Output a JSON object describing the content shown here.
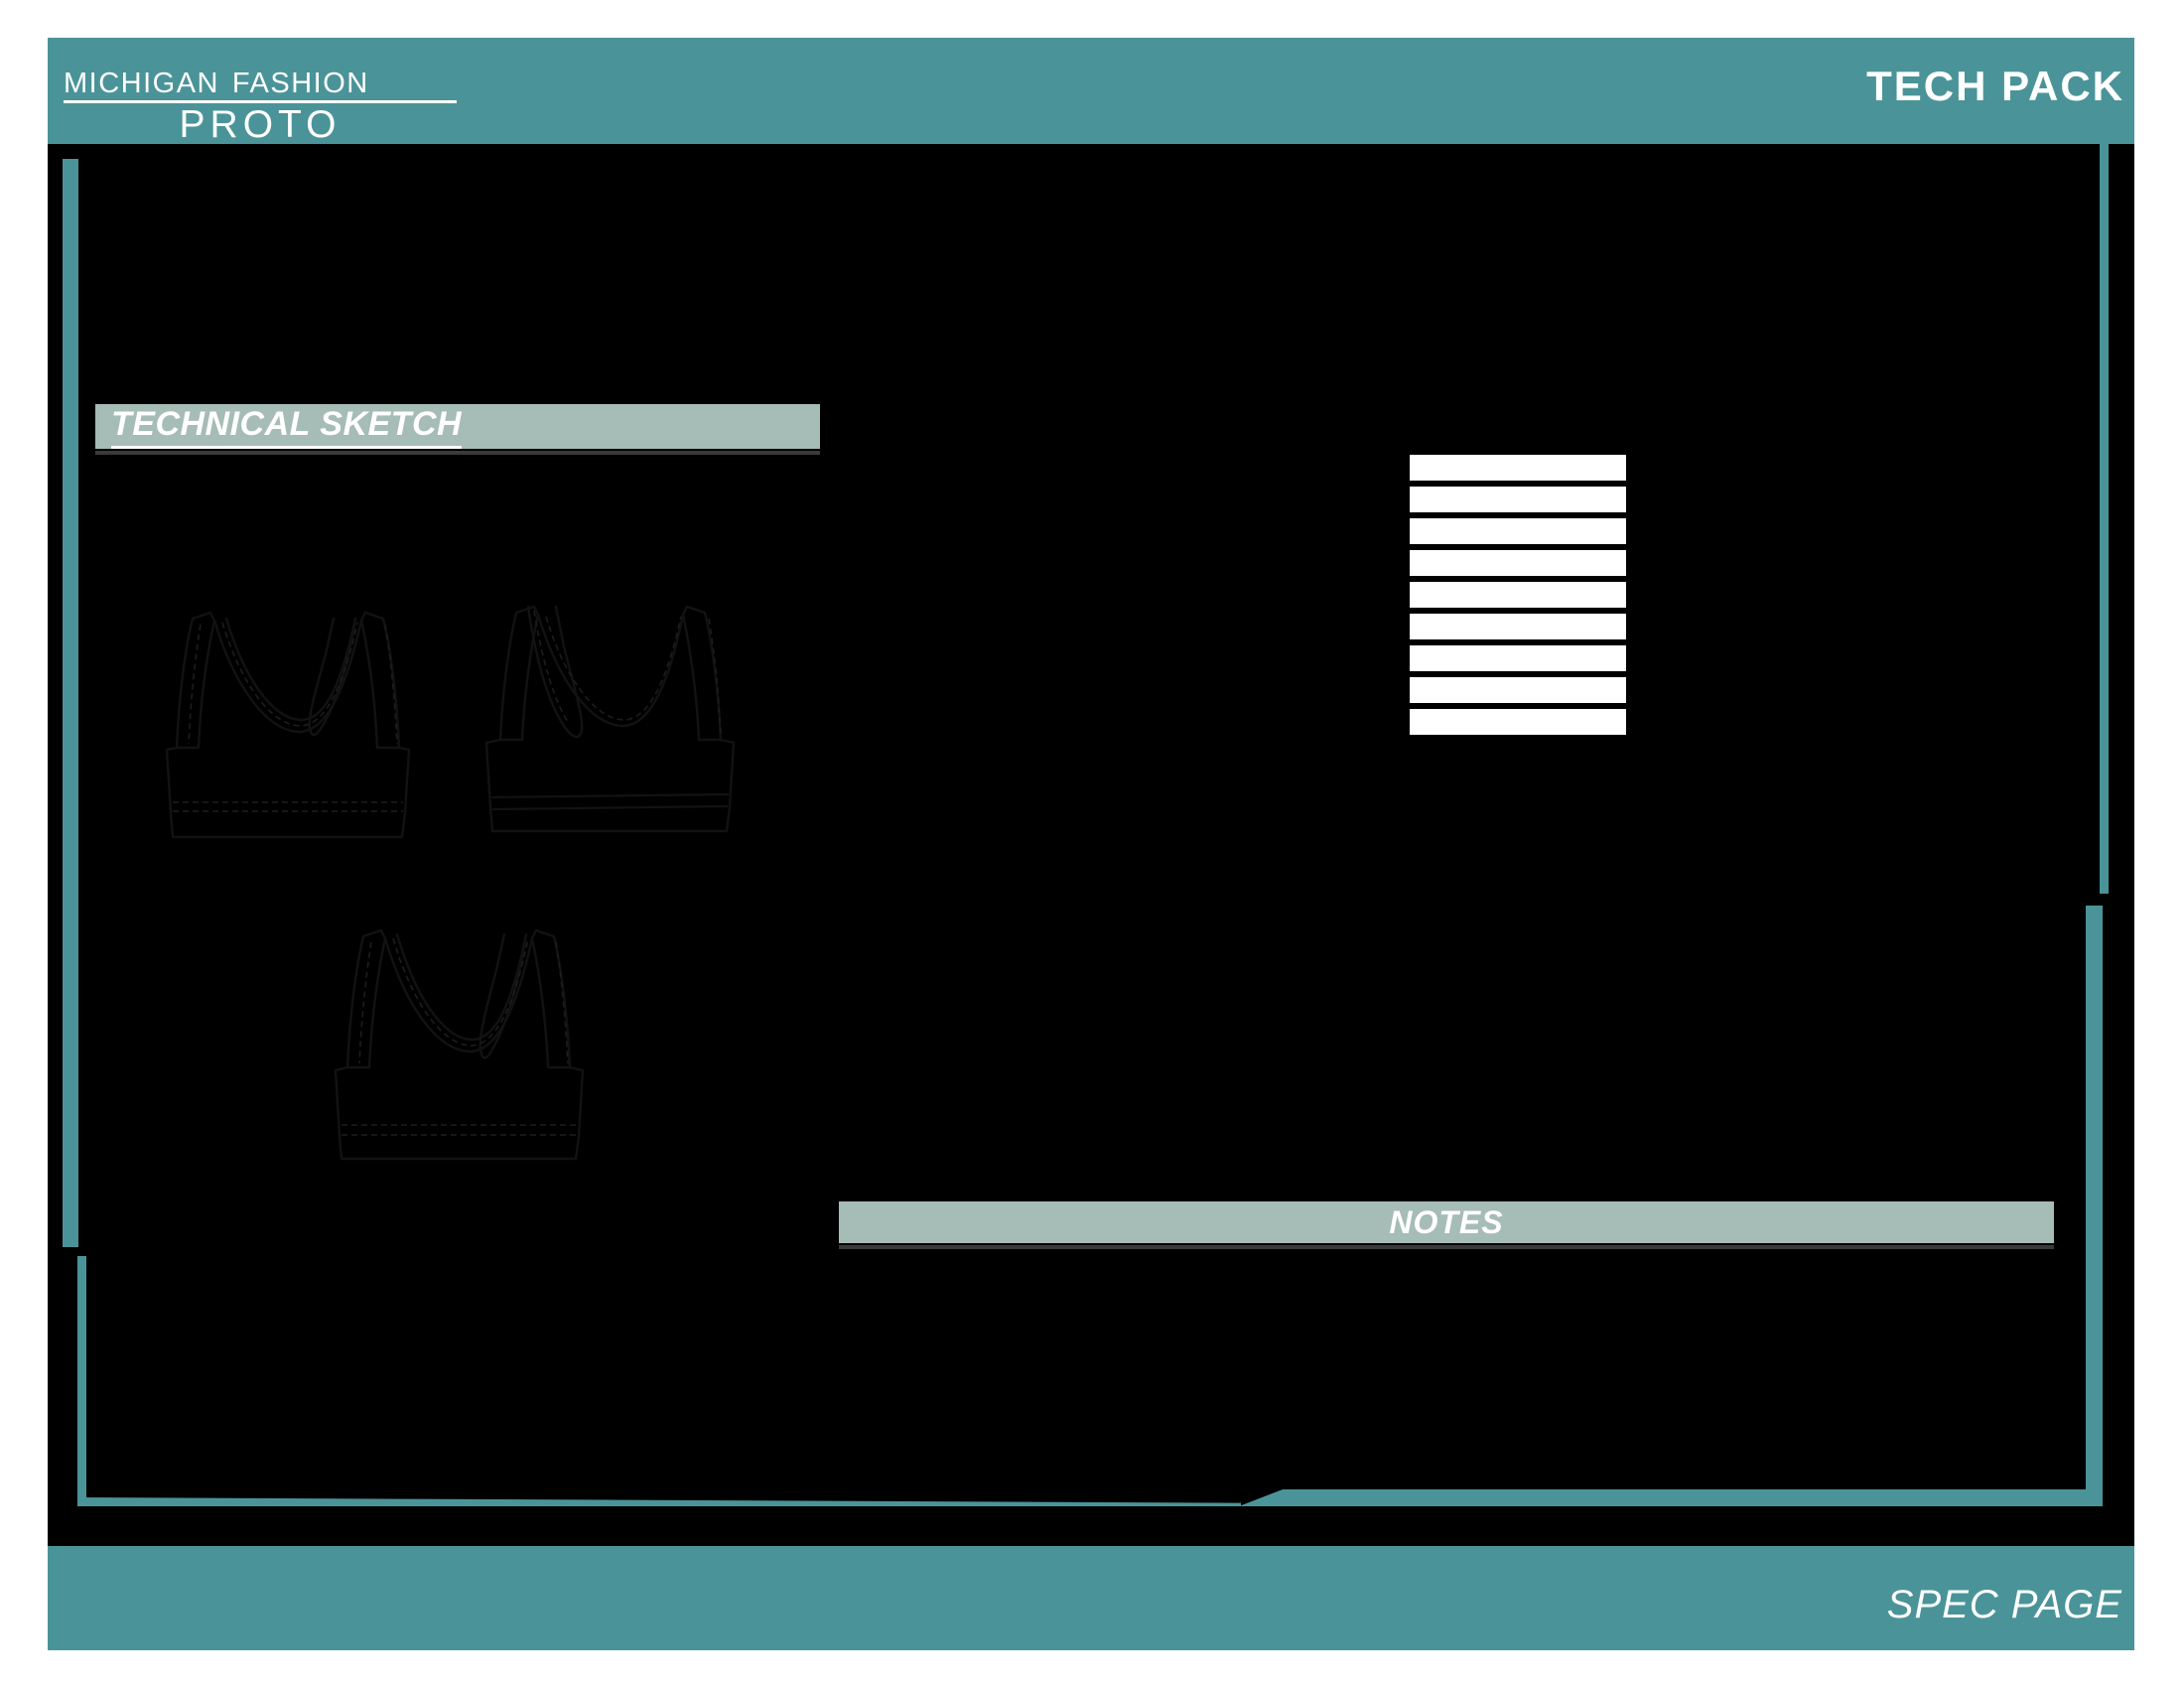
{
  "header": {
    "logo_line1": "Michigan Fashion",
    "logo_line2": "PROTO",
    "title": "TECH PACK"
  },
  "sections": {
    "technical_sketch_label": "TECHNICAL SKETCH",
    "notes_label": "NOTES"
  },
  "spec_table": {
    "rows": [
      "",
      "",
      "",
      "",
      "",
      "",
      "",
      "",
      ""
    ]
  },
  "sketches": [
    {
      "name": "front-view",
      "caption": ""
    },
    {
      "name": "back-view",
      "caption": ""
    },
    {
      "name": "side-view",
      "caption": ""
    }
  ],
  "footer": {
    "page_label": "SPEC PAGE"
  },
  "colors": {
    "teal": "#4a9499",
    "banner_gray": "#a6bcb6",
    "canvas": "#000000",
    "text_light": "#ffffff"
  }
}
